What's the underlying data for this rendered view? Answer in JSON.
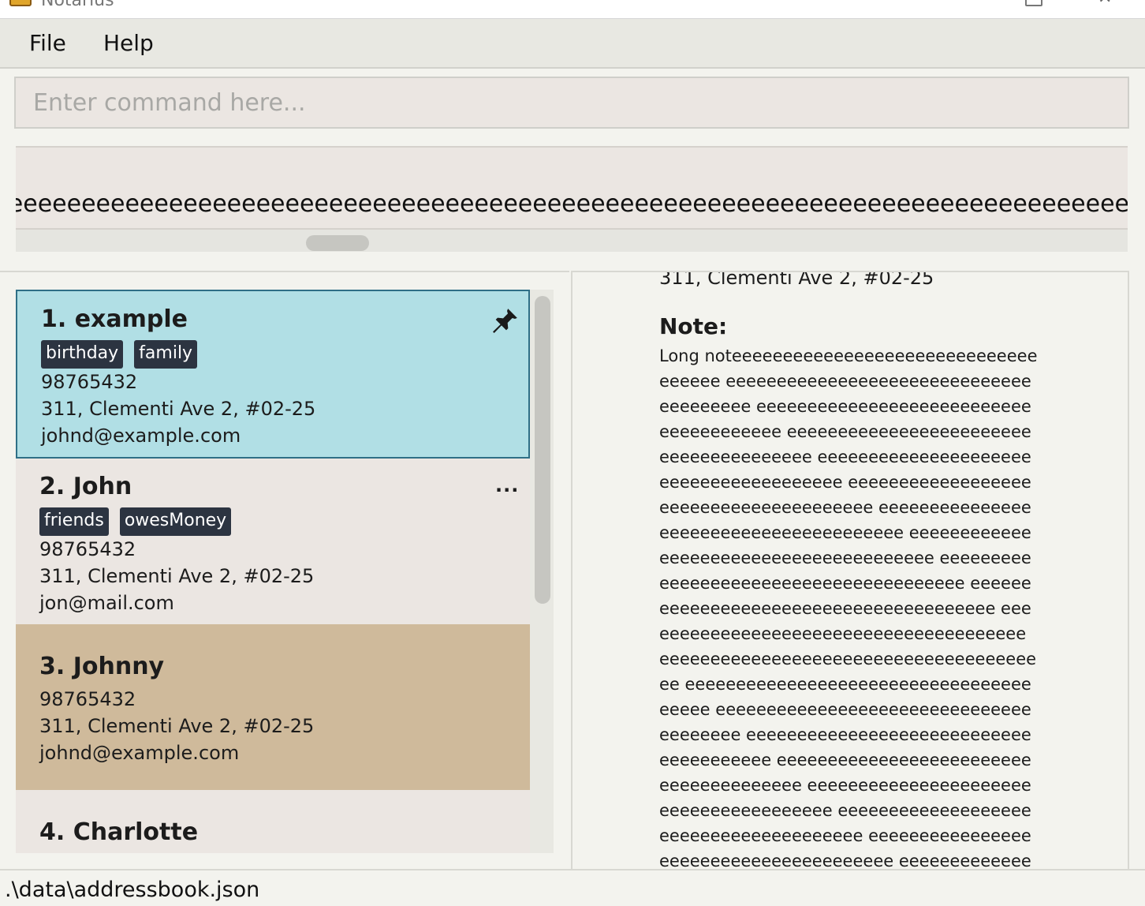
{
  "window": {
    "title": "Notarius"
  },
  "menu": {
    "file_label": "File",
    "help_label": "Help"
  },
  "command": {
    "placeholder": "Enter command here...",
    "value": ""
  },
  "result": {
    "text": "eeeeeeeeeeeeeeeeeeeeeeeeeeeeeeeeeeeeeeeeeeeeeeeeeeeeeeeeeeeeeeeeeeeeeeeeeeeeeeeeeeee"
  },
  "persons": [
    {
      "name": "1. example",
      "tags": [
        "birthday",
        "family"
      ],
      "phone": "98765432",
      "address": "311, Clementi Ave 2, #02-25",
      "email": "johnd@example.com",
      "icon": "pin-icon",
      "color": "#b1dfe5"
    },
    {
      "name": "2. John",
      "tags": [
        "friends",
        "owesMoney"
      ],
      "phone": "98765432",
      "address": "311, Clementi Ave 2, #02-25",
      "email": "jon@mail.com",
      "icon": "more-icon",
      "more": "..."
    },
    {
      "name": "3. Johnny",
      "tags": [],
      "phone": "98765432",
      "address": "311, Clementi Ave 2, #02-25",
      "email": "johnd@example.com",
      "color": "#cfba9b"
    },
    {
      "name": "4. Charlotte"
    }
  ],
  "detail": {
    "address": "311, Clementi Ave 2, #02-25",
    "note_heading": "Note:",
    "note_body": "Long noteeeeeeeeeeeeeeeeeeeeeeeeeeeeeeeeeeee eeeeeeeeeeeeeeeeeeeeeeeeeeeeeeeeeeeeeee eeeeeeeeeeeeeeeeeeeeeeeeeeeeeeeeeeeeeee eeeeeeeeeeeeeeeeeeeeeeeeeeeeeeeeeeeeeee eeeeeeeeeeeeeeeeeeeeeeeeeeeeeeeeeeeeeee eeeeeeeeeeeeeeeeeeeeeeeeeeeeeeeeeeeeeee eeeeeeeeeeeeeeeeeeeeeeeeeeeeeeeeeeeeeee eeeeeeeeeeeeeeeeeeeeeeeeeeeeeeeeeeeeeee eeeeeeeeeeeeeeeeeeeeeeeeeeeeeeeeeeeeeee eeeeeeeeeeeeeeeeeeeeeeeeeeeeeeeeeeeeeee eeeeeeeeeeeeeeeeeeeeeeeeeeeeeeeeeeeeeee eeeeeeeeeeeeeeeeeeeeeeeeeeeeeeeeeeeeeee eeeeeeeeeeeeeeeeeeeeeeeeeeeeeeeeeeeeeee eeeeeeeeeeeeeeeeeeeeeeeeeeeeeeeeeeeeeee eeeeeeeeeeeeeeeeeeeeeeeeeeeeeeeeeeeeeee eeeeeeeeeeeeeeeeeeeeeeeeeeeeeeeeeeeeeee eeeeeeeeeeeeeeeeeeeeeeeeeeeeeeeeeeeeeee eeeeeeeeeeeeeeeeeeeeeeeeeeeeeeeeeeeeeee eeeeeeeeeeeeeeeeeeeeeeeeeeeeeeeeeeeeeee eeeeeeeeeeeeeeeeeeeeeeeeeeeeeeeeeeeeeee"
  },
  "status": {
    "path": ".\\data\\addressbook.json"
  }
}
